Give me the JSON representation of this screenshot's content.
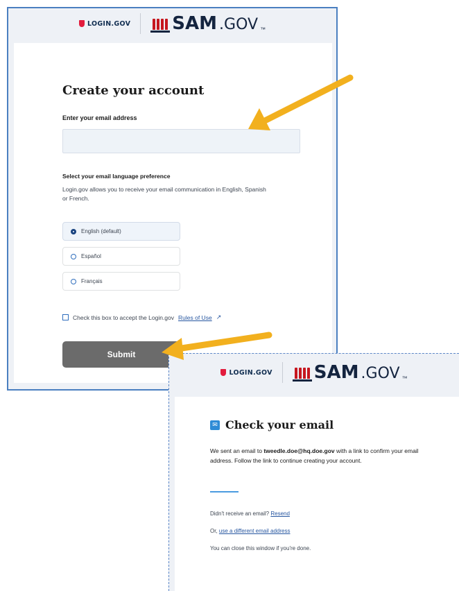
{
  "create_account": {
    "brand": {
      "login_gov": "LOGIN.GOV",
      "sam": "SAM",
      "gov": ".GOV",
      "tm": "™"
    },
    "title": "Create your account",
    "email_label": "Enter your email address",
    "email_value": "",
    "language_label": "Select your email language preference",
    "language_description": "Login.gov allows you to receive your email communication in English, Spanish or French.",
    "language_options": [
      "English (default)",
      "Español",
      "Français"
    ],
    "selected_language": "English (default)",
    "accept_text": "Check this box to accept the Login.gov",
    "rules_link": "Rules of Use",
    "accept_checked": false,
    "submit_label": "Submit"
  },
  "check_email": {
    "brand": {
      "login_gov": "LOGIN.GOV",
      "sam": "SAM",
      "gov": ".GOV",
      "tm": "™"
    },
    "title": "Check your email",
    "sent_prefix": "We sent an email to",
    "email_address": "tweedle.doe@hq.doe.gov",
    "sent_suffix": "with a link to confirm your email address. Follow the link to continue creating your account.",
    "resend_prompt": "Didn't receive an email?",
    "resend_link": "Resend",
    "different_prefix": "Or,",
    "different_link": "use a different email address",
    "close_text": "You can close this window if you're done."
  },
  "colors": {
    "arrow": "#f2b01e",
    "submit_bg": "#6b6b6b",
    "panel_border": "#4a7fc0",
    "link": "#2656a0",
    "login_gov_shield": "#e21c3d",
    "sam_red": "#c6161e",
    "sam_navy": "#14243f"
  },
  "icons": {
    "shield": "shield-icon",
    "uncle_sam_hat": "uncle-sam-hat-icon",
    "external_link": "external-link-icon",
    "email": "email-icon",
    "arrow": "arrow-icon"
  }
}
